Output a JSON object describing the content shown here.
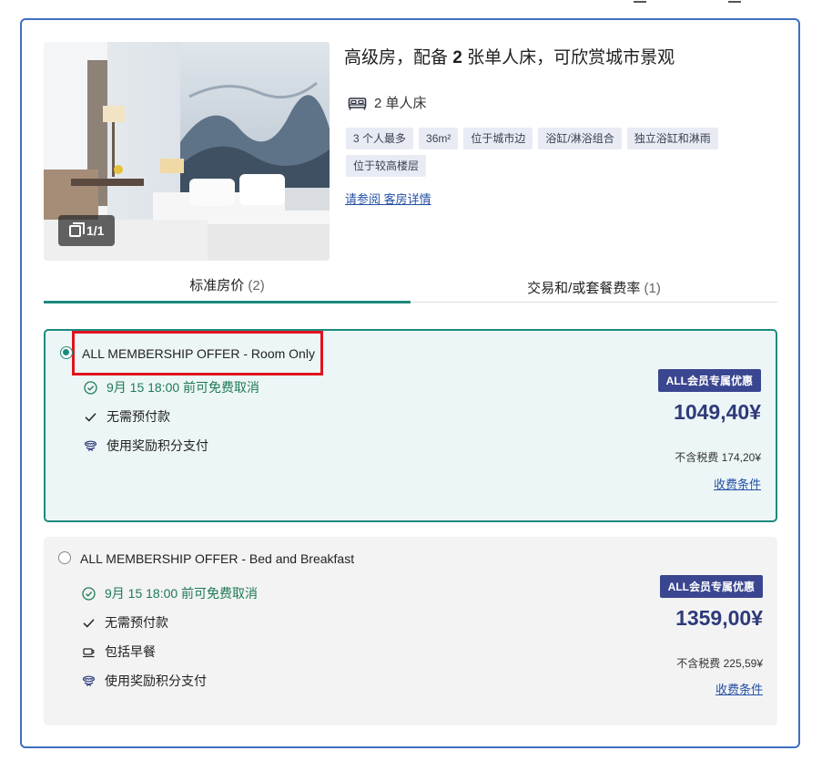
{
  "room": {
    "title_prefix": "高级房，配备",
    "title_bold": "2",
    "title_suffix": "张单人床，可欣赏城市景观",
    "photo_count": "1/1",
    "bed_text": "2 单人床",
    "tags": [
      "3 个人最多",
      "36m²",
      "位于城市边",
      "浴缸/淋浴组合",
      "独立浴缸和淋雨",
      "位于较高楼层"
    ],
    "details_link": "请参阅 客房详情"
  },
  "tabs": [
    {
      "label": "标准房价",
      "count": "(2)",
      "active": true
    },
    {
      "label": "交易和/或套餐费率",
      "count": "(1)",
      "active": false
    }
  ],
  "rates": [
    {
      "name": "ALL MEMBERSHIP OFFER - Room Only",
      "selected": true,
      "features": {
        "cancel": "9月 15 18:00 前可免费取消",
        "prepay": "无需预付款",
        "points": "使用奖励积分支付"
      },
      "badge": "ALL会员专属优惠",
      "price": "1049,40¥",
      "tax": "不含税费 174,20¥",
      "terms": "收费条件"
    },
    {
      "name": "ALL MEMBERSHIP OFFER - Bed and Breakfast",
      "selected": false,
      "features": {
        "cancel": "9月 15 18:00 前可免费取消",
        "prepay": "无需预付款",
        "breakfast": "包括早餐",
        "points": "使用奖励积分支付"
      },
      "badge": "ALL会员专属优惠",
      "price": "1359,00¥",
      "tax": "不含税费 225,59¥",
      "terms": "收费条件"
    }
  ],
  "colors": {
    "border_blue": "#3f6fc1",
    "teal": "#1e8a7e",
    "price_navy": "#2e3a7a",
    "badge_navy": "#3a4690",
    "highlight_red": "#e0141e",
    "cancel_green": "#1e7a56"
  }
}
